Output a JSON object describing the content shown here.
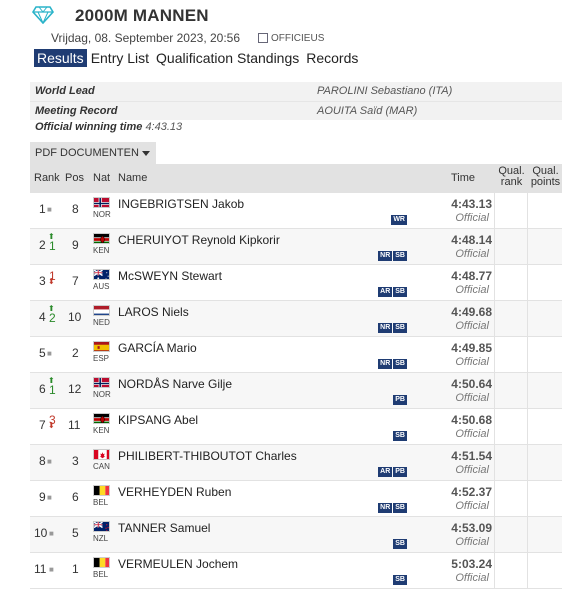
{
  "header": {
    "logo_icon": "diamond-icon",
    "title": "2000M MANNEN",
    "datetime": "Vrijdag, 08. September 2023, 20:56",
    "officieus_label": "OFFICIEUS"
  },
  "tabs": [
    {
      "label": "Results",
      "active": true
    },
    {
      "label": "Entry List",
      "active": false
    },
    {
      "label": "Qualification Standings",
      "active": false
    },
    {
      "label": "Records",
      "active": false
    }
  ],
  "records": {
    "world_lead_label": "World Lead",
    "world_lead_value": "PAROLINI Sebastiano (ITA)",
    "meeting_record_label": "Meeting Record",
    "meeting_record_value": "AOUITA Saïd (MAR)",
    "winning_time_label": "Official winning time",
    "winning_time_value": "4:43.13"
  },
  "pdf_label": "PDF DOCUMENTEN",
  "table": {
    "headers": {
      "rank": "Rank",
      "pos": "Pos",
      "nat": "Nat",
      "name": "Name",
      "time": "Time",
      "qual_rank": "Qual. rank",
      "qual_points": "Qual. points"
    },
    "official_label": "Official",
    "rows": [
      {
        "rank": "1",
        "move": "same",
        "move_val": "",
        "pos": "8",
        "nat": "NOR",
        "name": "INGEBRIGTSEN Jakob",
        "badges": [
          "WR"
        ],
        "time": "4:43.13"
      },
      {
        "rank": "2",
        "move": "up",
        "move_val": "1",
        "pos": "9",
        "nat": "KEN",
        "name": "CHERUIYOT Reynold Kipkorir",
        "badges": [
          "NR",
          "SB"
        ],
        "time": "4:48.14"
      },
      {
        "rank": "3",
        "move": "down",
        "move_val": "1",
        "pos": "7",
        "nat": "AUS",
        "name": "McSWEYN Stewart",
        "badges": [
          "AR",
          "SB"
        ],
        "time": "4:48.77"
      },
      {
        "rank": "4",
        "move": "up",
        "move_val": "2",
        "pos": "10",
        "nat": "NED",
        "name": "LAROS Niels",
        "badges": [
          "NR",
          "SB"
        ],
        "time": "4:49.68"
      },
      {
        "rank": "5",
        "move": "same",
        "move_val": "",
        "pos": "2",
        "nat": "ESP",
        "name": "GARCÍA Mario",
        "badges": [
          "NR",
          "SB"
        ],
        "time": "4:49.85"
      },
      {
        "rank": "6",
        "move": "up",
        "move_val": "1",
        "pos": "12",
        "nat": "NOR",
        "name": "NORDÅS Narve Gilje",
        "badges": [
          "PB"
        ],
        "time": "4:50.64"
      },
      {
        "rank": "7",
        "move": "down",
        "move_val": "3",
        "pos": "11",
        "nat": "KEN",
        "name": "KIPSANG Abel",
        "badges": [
          "SB"
        ],
        "time": "4:50.68"
      },
      {
        "rank": "8",
        "move": "same",
        "move_val": "",
        "pos": "3",
        "nat": "CAN",
        "name": "PHILIBERT-THIBOUTOT Charles",
        "badges": [
          "AR",
          "PB"
        ],
        "time": "4:51.54"
      },
      {
        "rank": "9",
        "move": "same",
        "move_val": "",
        "pos": "6",
        "nat": "BEL",
        "name": "VERHEYDEN Ruben",
        "badges": [
          "NR",
          "SB"
        ],
        "time": "4:52.37"
      },
      {
        "rank": "10",
        "move": "same",
        "move_val": "",
        "pos": "5",
        "nat": "NZL",
        "name": "TANNER Samuel",
        "badges": [
          "SB"
        ],
        "time": "4:53.09"
      },
      {
        "rank": "11",
        "move": "same",
        "move_val": "",
        "pos": "1",
        "nat": "BEL",
        "name": "VERMEULEN Jochem",
        "badges": [
          "SB"
        ],
        "time": "5:03.24"
      }
    ]
  },
  "colors": {
    "accent": "#1f3c73",
    "logo": "#2ab3c9",
    "up": "#2a8a2a",
    "down": "#c0392b"
  }
}
